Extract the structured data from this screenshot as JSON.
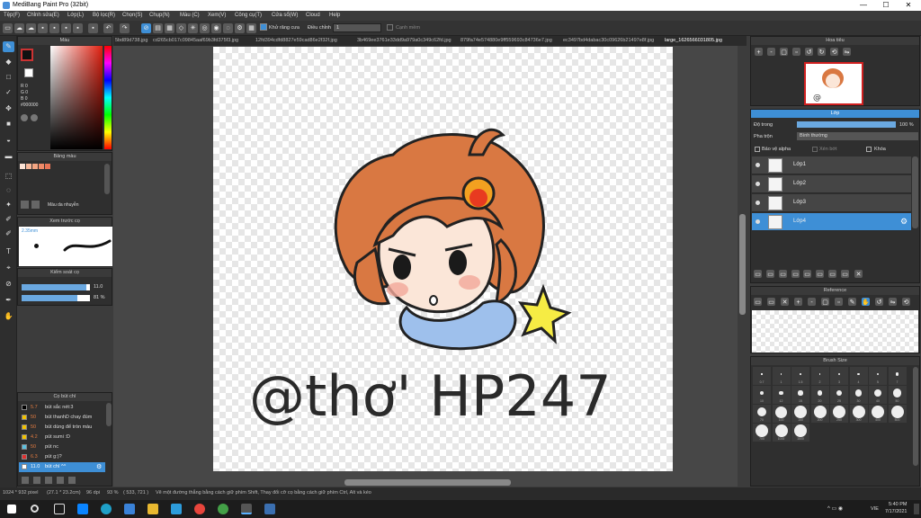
{
  "window": {
    "title": "MediBang Paint Pro (32bit)",
    "minimize": "—",
    "maximize": "☐",
    "close": "✕"
  },
  "menu": [
    "Tệp(F)",
    "Chỉnh sửa(E)",
    "Lớp(L)",
    "Bộ lọc(R)",
    "Chọn(S)",
    "Chụp(N)",
    "Màu (C)",
    "Xem(V)",
    "Công cụ(T)",
    "Cửa sổ(W)",
    "Cloud",
    "Help"
  ],
  "toolbar": {
    "khu_vuc_label": "Khử răng cưa",
    "dieu_chinh_label": "Điều chỉnh",
    "dieu_chinh_value": "1",
    "canh_mem_label": "Cạnh mềm"
  },
  "tabs": [
    "5bd89d738.jpg",
    "cd265cb017c09845aaf69b3fd375f3.jpg",
    "12fd394cdfd8827e59cad86e2f32f.jpg",
    "3b469ee3761e33dd9a979a0c349c62fd.jpg",
    "879fa74e574880e9ff559693c84736e7.jpg",
    "ec3497bd4dabac30c09626b21497e8f.jpg",
    "large_1626566031805.jpg"
  ],
  "color_panel": {
    "title": "Màu",
    "r": "R 0",
    "g": "G 0",
    "b": "B 0",
    "hex": "#000000"
  },
  "palette_panel": {
    "title": "Bảng màu",
    "dropdown": "Màu da nhuyễn"
  },
  "brush_preview": {
    "title": "Xem trước cọ",
    "size": "2.35mm"
  },
  "brush_control": {
    "title": "Kiểm soát cọ",
    "size_value": "11.0",
    "opacity_value": "81 %",
    "size_fill": 0.95,
    "opacity_fill": 0.81
  },
  "brush_list": {
    "title": "Cọ bút chì",
    "items": [
      {
        "num": "5.7",
        "name": "bút sắc nét:3",
        "color": "#000000"
      },
      {
        "num": "50",
        "name": "bút thanhD chay đúm",
        "color": "#f2c200"
      },
      {
        "num": "50",
        "name": "bút dùng để tròn màu",
        "color": "#f2c200"
      },
      {
        "num": "4.2",
        "name": "pút sumi :D",
        "color": "#f2c200"
      },
      {
        "num": "50",
        "name": "pút nc",
        "color": "#5bc0de"
      },
      {
        "num": "6.3",
        "name": "pút g:)?",
        "color": "#e03030"
      },
      {
        "num": "11.0",
        "name": "bút chì ^^",
        "color": "#ffffff"
      }
    ]
  },
  "navigator": {
    "title": "Hoa tiêu"
  },
  "layer_panel": {
    "title": "Lớp",
    "opacity_label": "Độ trong",
    "opacity_value": "100 %",
    "opacity_fill": 1.0,
    "blend_label": "Pha trộn",
    "blend_value": "Bình thường",
    "protect_alpha": "Bảo vệ alpha",
    "clipping": "Xén bớt",
    "lock": "Khóa",
    "layers": [
      {
        "name": "Lớp1",
        "selected": false
      },
      {
        "name": "Lớp2",
        "selected": false
      },
      {
        "name": "Lớp3",
        "selected": false
      },
      {
        "name": "Lớp4",
        "selected": true
      }
    ]
  },
  "reference_panel": {
    "title": "Reference"
  },
  "brush_size_panel": {
    "title": "Brush Size",
    "sizes": [
      "0.7",
      "1",
      "1.5",
      "2",
      "3",
      "4",
      "5",
      "7",
      "10",
      "12",
      "15",
      "20",
      "25",
      "30",
      "40",
      "50",
      "70",
      "100",
      "150",
      "200",
      "250",
      "300",
      "400",
      "500",
      "700",
      "1000",
      "1500"
    ]
  },
  "canvas_text": "@thơ' HP247",
  "status": {
    "dims": "1024 * 932 pixel",
    "cm": "(27.1 * 23.2cm)",
    "dpi": "96 dpi",
    "zoom": "93 %",
    "coords": "( 533, 721 )",
    "hint": "Vẽ một đường thẳng bằng cách giữ phím Shift, Thay đổi cỡ cọ bằng cách giữ phím Ctrl, Alt và kéo"
  },
  "taskbar": {
    "time": "5:40 PM",
    "date": "7/17/2021",
    "lang": "VIE"
  }
}
